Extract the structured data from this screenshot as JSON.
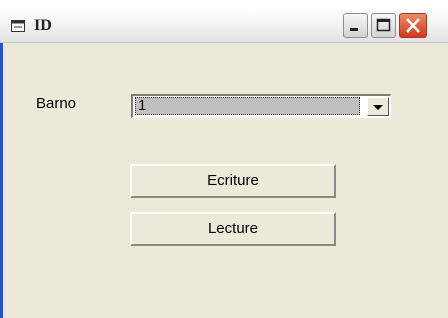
{
  "window": {
    "title": "ID",
    "icons": {
      "app": "window-app-icon",
      "minimize": "minimize-icon",
      "maximize": "maximize-icon",
      "close": "close-icon"
    }
  },
  "form": {
    "barno_label": "Barno",
    "barno_value": "1",
    "ecriture_label": "Ecriture",
    "lecture_label": "Lecture"
  },
  "colors": {
    "titlebar_close": "#d9502c",
    "window_border": "#1d55d6",
    "client_background": "#ece9d8",
    "annotation_arrow": "#e8332a"
  }
}
